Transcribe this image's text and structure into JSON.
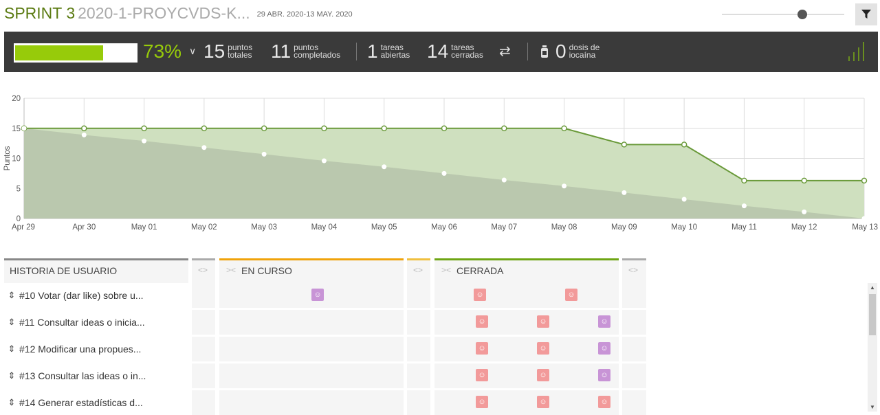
{
  "header": {
    "sprint_label": "SPRINT 3",
    "sprint_name": "2020-1-PROYCVDS-K...",
    "date_range": "29 ABR. 2020-13 MAY. 2020",
    "filter_icon": "filter-icon"
  },
  "summary": {
    "progress_fraction": 0.73,
    "percent": "73%",
    "total_points": "15",
    "total_points_label1": "puntos",
    "total_points_label2": "totales",
    "completed_points": "11",
    "completed_points_label1": "puntos",
    "completed_points_label2": "completados",
    "open_tasks": "1",
    "open_tasks_label1": "tareas",
    "open_tasks_label2": "abiertas",
    "closed_tasks": "14",
    "closed_tasks_label1": "tareas",
    "closed_tasks_label2": "cerradas",
    "iocaine": "0",
    "iocaine_label1": "dosis de",
    "iocaine_label2": "iocaína"
  },
  "chart_data": {
    "type": "area",
    "ylabel": "Puntos",
    "ylim": [
      0,
      20
    ],
    "yticks": [
      0,
      5,
      10,
      15,
      20
    ],
    "categories": [
      "Apr 29",
      "Apr 30",
      "May 01",
      "May 02",
      "May 03",
      "May 04",
      "May 05",
      "May 06",
      "May 07",
      "May 08",
      "May 09",
      "May 10",
      "May 11",
      "May 12",
      "May 13"
    ],
    "series": [
      {
        "name": "",
        "values": [
          15,
          15,
          15,
          15,
          15,
          15,
          15,
          15,
          15,
          15,
          12.3,
          12.3,
          6.3,
          6.3,
          6.3
        ],
        "color": "#6a9a3a"
      },
      {
        "name": "",
        "values": [
          15,
          13.9,
          12.9,
          11.8,
          10.7,
          9.6,
          8.6,
          7.5,
          6.4,
          5.4,
          4.3,
          3.2,
          2.1,
          1.1,
          0
        ],
        "color": "#a9b99e"
      }
    ],
    "grid": true
  },
  "board": {
    "columns": [
      {
        "label": "HISTORIA DE USUARIO"
      },
      {
        "label": "EN CURSO",
        "color": "#f0a30a"
      },
      {
        "label": "CERRADA",
        "color": "#6ea514"
      }
    ],
    "rows": [
      {
        "label": "#10 Votar (dar like) sobre u...",
        "en_curso": [
          "purple"
        ],
        "cerrada": [
          "pink",
          "pink"
        ]
      },
      {
        "label": "#11 Consultar ideas o inicia...",
        "en_curso": [],
        "cerrada": [
          "pink",
          "pink",
          "purple"
        ]
      },
      {
        "label": "#12 Modificar una propues...",
        "en_curso": [],
        "cerrada": [
          "pink",
          "pink",
          "purple"
        ]
      },
      {
        "label": "#13 Consultar las ideas o in...",
        "en_curso": [],
        "cerrada": [
          "pink",
          "pink",
          "purple"
        ]
      },
      {
        "label": "#14 Generar estadísticas d...",
        "en_curso": [],
        "cerrada": [
          "pink",
          "pink",
          "pink"
        ]
      }
    ]
  }
}
